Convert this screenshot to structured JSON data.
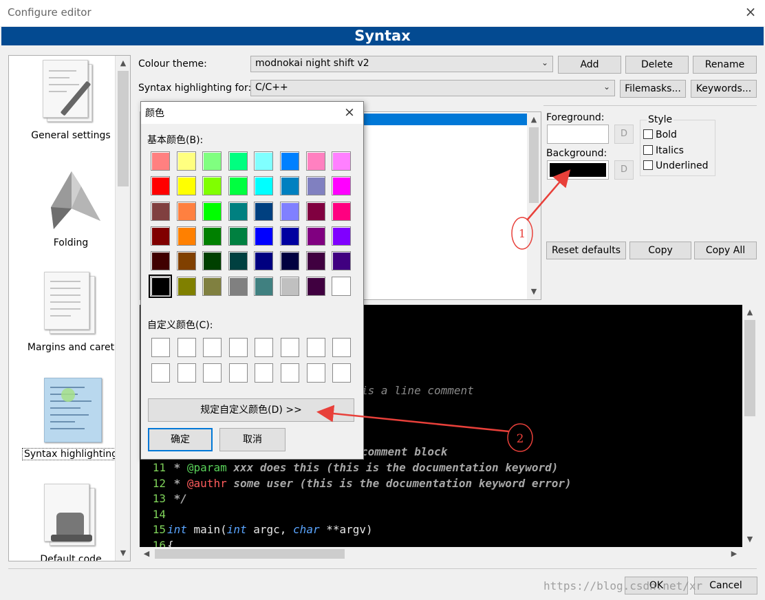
{
  "window": {
    "title": "Configure editor",
    "close_glyph": "×"
  },
  "banner": {
    "title": "Syntax"
  },
  "sidebar": {
    "items": [
      {
        "label": "General settings",
        "icon": "general-settings-icon"
      },
      {
        "label": "Folding",
        "icon": "folding-icon"
      },
      {
        "label": "Margins and caret",
        "icon": "margins-icon"
      },
      {
        "label": "Syntax highlighting",
        "icon": "syntax-icon",
        "selected": true
      },
      {
        "label": "Default code",
        "icon": "default-code-icon"
      }
    ]
  },
  "theme": {
    "label": "Colour theme:",
    "value": "modnokai night shift v2",
    "add": "Add",
    "delete": "Delete",
    "rename": "Rename"
  },
  "syntax_for": {
    "label": "Syntax highlighting for:",
    "value": "C/C++",
    "filemasks": "Filemasks...",
    "keywords": "Keywords..."
  },
  "colors": {
    "foreground_label": "Foreground:",
    "background_label": "Background:",
    "d_label": "D",
    "foreground_value": "#ffffff",
    "background_value": "#000000"
  },
  "style": {
    "title": "Style",
    "bold": "Bold",
    "italics": "Italics",
    "underlined": "Underlined"
  },
  "actions": {
    "reset": "Reset defaults",
    "copy": "Copy",
    "copy_all": "Copy All"
  },
  "code": {
    "partial_comment": "is a line comment",
    "partial_block": "comment block",
    "lines": [
      {
        "num": "11",
        "parts": [
          [
            "c-doc",
            " * "
          ],
          [
            "c-kw",
            "@param"
          ],
          [
            "c-doc",
            " xxx does this (this is the documentation keyword)"
          ]
        ]
      },
      {
        "num": "12",
        "parts": [
          [
            "c-doc",
            " * "
          ],
          [
            "c-kwerr",
            "@authr"
          ],
          [
            "c-doc",
            " some user (this is the documentation keyword error)"
          ]
        ]
      },
      {
        "num": "13",
        "parts": [
          [
            "c-doc",
            " */"
          ]
        ]
      },
      {
        "num": "14",
        "parts": []
      },
      {
        "num": "15",
        "parts": [
          [
            "c-type",
            "int"
          ],
          [
            "c-text",
            " main("
          ],
          [
            "c-type",
            "int"
          ],
          [
            "c-text",
            " argc, "
          ],
          [
            "c-type",
            "char"
          ],
          [
            "c-text",
            " **argv)"
          ]
        ]
      },
      {
        "num": "16",
        "parts": [
          [
            "c-text",
            "{"
          ]
        ]
      }
    ]
  },
  "footer": {
    "ok": "OK",
    "cancel": "Cancel",
    "watermark": "https://blog.csdn.net/xr"
  },
  "color_dialog": {
    "title": "颜色",
    "basic_label": "基本颜色(B):",
    "custom_label": "自定义颜色(C):",
    "define_custom": "规定自定义颜色(D) >>",
    "ok": "确定",
    "cancel": "取消",
    "selected_index": 40,
    "basic_colors": [
      "#ff8080",
      "#ffff80",
      "#80ff80",
      "#00ff80",
      "#80ffff",
      "#0080ff",
      "#ff80c0",
      "#ff80ff",
      "#ff0000",
      "#ffff00",
      "#80ff00",
      "#00ff40",
      "#00ffff",
      "#0080c0",
      "#8080c0",
      "#ff00ff",
      "#804040",
      "#ff8040",
      "#00ff00",
      "#008080",
      "#004080",
      "#8080ff",
      "#800040",
      "#ff0080",
      "#800000",
      "#ff8000",
      "#008000",
      "#008040",
      "#0000ff",
      "#0000a0",
      "#800080",
      "#8000ff",
      "#400000",
      "#804000",
      "#004000",
      "#004040",
      "#000080",
      "#000040",
      "#400040",
      "#400080",
      "#000000",
      "#808000",
      "#808040",
      "#808080",
      "#408080",
      "#c0c0c0",
      "#400040",
      "#ffffff"
    ]
  },
  "annotations": {
    "marker_1": "1",
    "marker_2": "2",
    "arrow_color": "#e8403a"
  }
}
